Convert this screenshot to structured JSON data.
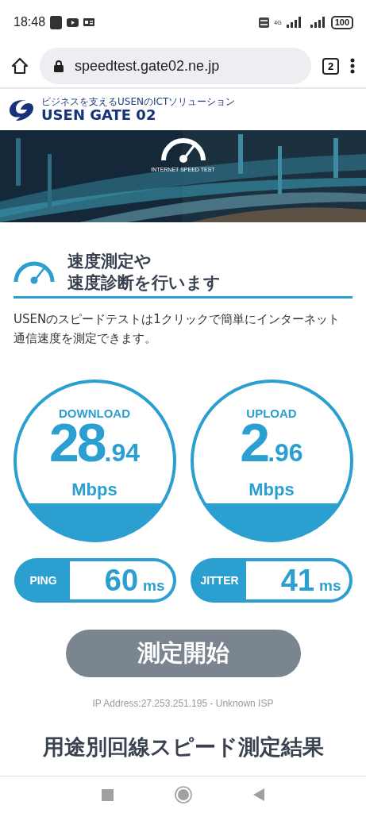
{
  "status_bar": {
    "time": "18:48",
    "network": "4G",
    "battery": "100"
  },
  "browser": {
    "url": "speedtest.gate02.ne.jp",
    "tab_count": "2"
  },
  "site": {
    "tagline": "ビジネスを支えるUSENのICTソリューション",
    "logo": "USEN GATE 02"
  },
  "banner": {
    "kind": "picture",
    "caption": "INTERNET SPEED TEST"
  },
  "intro": {
    "heading_lines": [
      "速度測定や",
      "速度診断を行います"
    ],
    "text": "USENのスピードテストは1クリックで簡単にインターネット通信速度を測定できます。"
  },
  "results": [
    {
      "label": "DOWNLOAD",
      "integer": "28",
      "decimal": ".94",
      "unit": "Mbps"
    },
    {
      "label": "UPLOAD",
      "integer": "2",
      "decimal": ".96",
      "unit": "Mbps"
    }
  ],
  "metrics": [
    {
      "label": "PING",
      "value": "60",
      "unit": "ms"
    },
    {
      "label": "JITTER",
      "value": "41",
      "unit": "ms"
    }
  ],
  "start_button": "測定開始",
  "ip_info": "IP Address:27.253.251.195 - Unknown ISP",
  "next_heading": "用途別回線スピード測定結果"
}
